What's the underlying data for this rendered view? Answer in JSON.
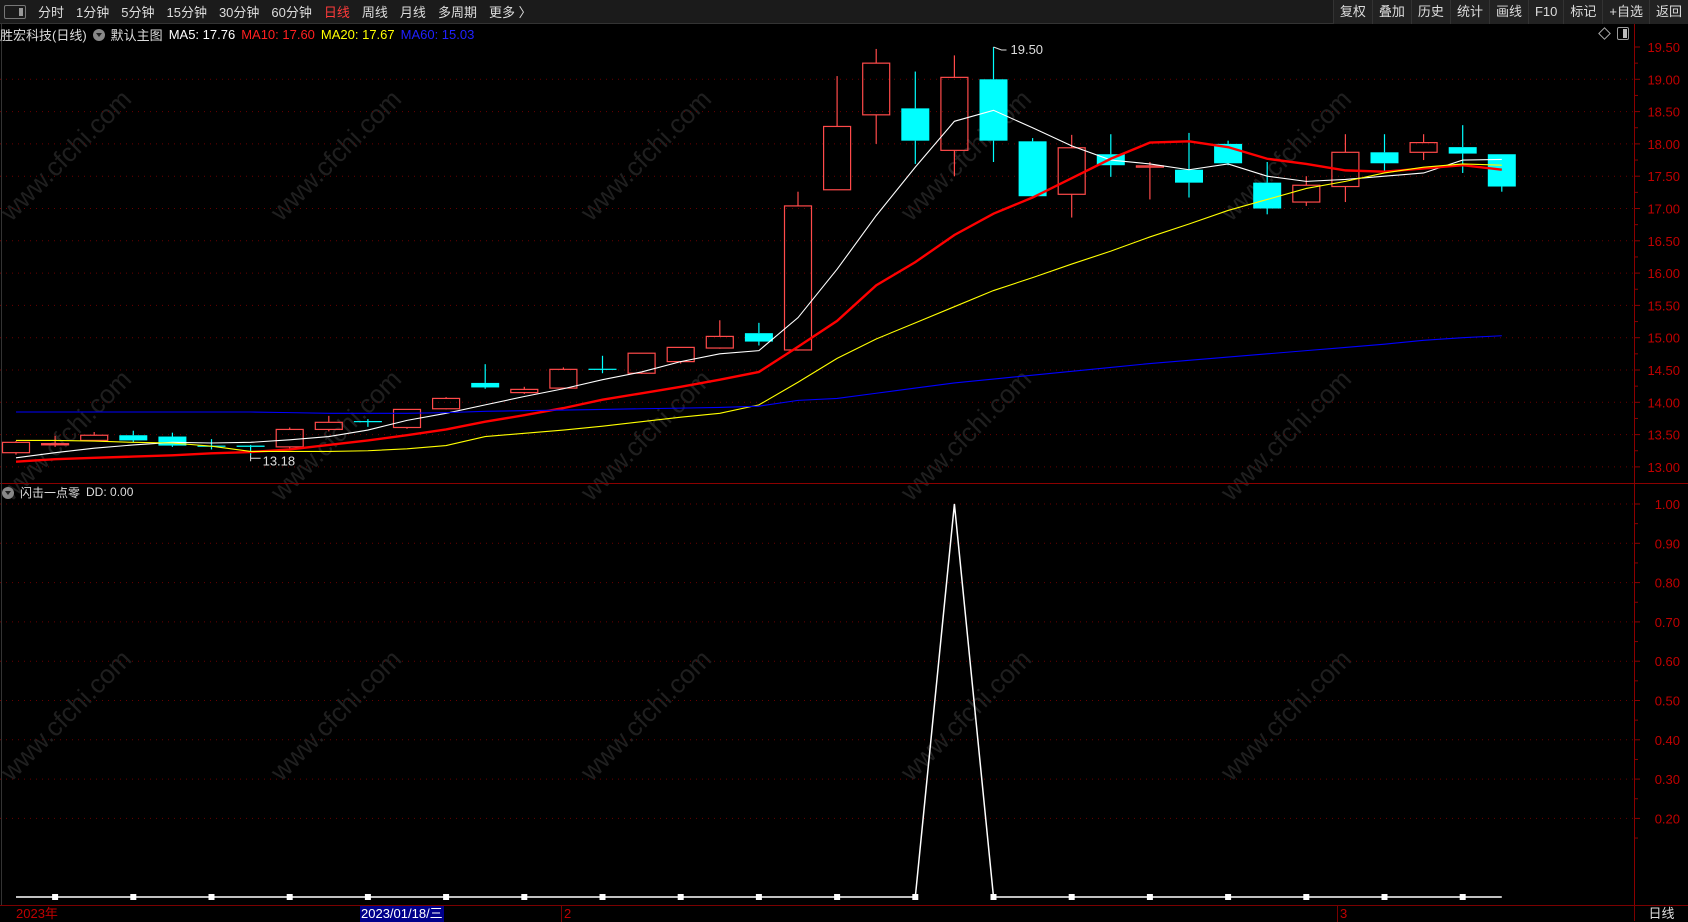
{
  "toolbar": {
    "periods": [
      "分时",
      "1分钟",
      "5分钟",
      "15分钟",
      "30分钟",
      "60分钟",
      "日线",
      "周线",
      "月线",
      "多周期",
      "更多 〉"
    ],
    "active_period": "日线",
    "right_buttons": [
      "复权",
      "叠加",
      "历史",
      "统计",
      "画线",
      "F10",
      "标记",
      "+自选",
      "返回"
    ]
  },
  "info": {
    "stock_name": "胜宏科技(日线)",
    "template": "默认主图",
    "ma5": "MA5: 17.76",
    "ma10": "MA10: 17.60",
    "ma20": "MA20: 17.67",
    "ma60": "MA60: 15.03"
  },
  "indicator": {
    "name": "闪击一点零",
    "value": "DD: 0.00"
  },
  "colors": {
    "up": "#ff4a4a",
    "down": "#00ffff",
    "ma5": "#ffffff",
    "ma10": "#ff0000",
    "ma20": "#ffff00",
    "ma60": "#0000ff",
    "axis": "#c00000"
  },
  "price_axis": {
    "ticks": [
      "19.50",
      "19.00",
      "18.50",
      "18.00",
      "17.50",
      "17.00",
      "16.50",
      "16.00",
      "15.50",
      "15.00",
      "14.50",
      "14.00",
      "13.50",
      "13.00"
    ]
  },
  "indicator_axis": {
    "ticks": [
      "1.00",
      "0.90",
      "0.80",
      "0.70",
      "0.60",
      "0.50",
      "0.40",
      "0.30",
      "0.20"
    ]
  },
  "annotations": {
    "high": "19.50",
    "low": "13.18"
  },
  "dates": {
    "year": "2023年",
    "selected": "2023/01/18/三",
    "month2": "2",
    "month3": "3"
  },
  "period_label": "日线",
  "watermark": "www.cfchi.com",
  "chart_data": {
    "type": "candlestick",
    "ylim": [
      12.9,
      19.6
    ],
    "candles": [
      [
        13.22,
        13.4,
        13.19,
        13.38
      ],
      [
        13.35,
        13.48,
        13.31,
        13.36
      ],
      [
        13.41,
        13.54,
        13.4,
        13.49
      ],
      [
        13.49,
        13.56,
        13.38,
        13.41
      ],
      [
        13.47,
        13.53,
        13.31,
        13.33
      ],
      [
        13.33,
        13.43,
        13.27,
        13.32
      ],
      [
        13.33,
        13.34,
        13.18,
        13.31
      ],
      [
        13.31,
        13.61,
        13.28,
        13.58
      ],
      [
        13.58,
        13.79,
        13.55,
        13.69
      ],
      [
        13.71,
        13.74,
        13.62,
        13.7
      ],
      [
        13.61,
        13.89,
        13.59,
        13.89
      ],
      [
        13.9,
        14.08,
        13.89,
        14.06
      ],
      [
        14.3,
        14.59,
        14.21,
        14.23
      ],
      [
        14.15,
        14.24,
        14.13,
        14.2
      ],
      [
        14.22,
        14.54,
        14.21,
        14.51
      ],
      [
        14.52,
        14.72,
        14.45,
        14.51
      ],
      [
        14.45,
        14.76,
        14.44,
        14.76
      ],
      [
        14.63,
        14.85,
        14.6,
        14.85
      ],
      [
        14.84,
        15.27,
        14.83,
        15.02
      ],
      [
        15.07,
        15.23,
        14.88,
        14.94
      ],
      [
        14.81,
        17.26,
        14.8,
        17.04
      ],
      [
        17.29,
        19.05,
        17.29,
        18.27
      ],
      [
        18.45,
        19.47,
        18.0,
        19.25
      ],
      [
        18.55,
        19.12,
        17.69,
        18.05
      ],
      [
        17.9,
        19.37,
        17.5,
        19.03
      ],
      [
        19.0,
        19.5,
        17.72,
        18.05
      ],
      [
        18.04,
        18.09,
        17.16,
        17.19
      ],
      [
        17.22,
        18.14,
        16.86,
        17.94
      ],
      [
        17.84,
        18.15,
        17.49,
        17.67
      ],
      [
        17.64,
        17.72,
        17.14,
        17.66
      ],
      [
        17.6,
        18.17,
        17.17,
        17.4
      ],
      [
        18.0,
        18.05,
        17.67,
        17.7
      ],
      [
        17.4,
        17.72,
        16.91,
        17.0
      ],
      [
        17.1,
        17.5,
        17.04,
        17.36
      ],
      [
        17.34,
        18.15,
        17.1,
        17.87
      ],
      [
        17.87,
        18.15,
        17.55,
        17.7
      ],
      [
        17.87,
        18.15,
        17.75,
        18.02
      ],
      [
        17.95,
        18.29,
        17.55,
        17.85
      ],
      [
        17.84,
        17.84,
        17.26,
        17.34
      ]
    ],
    "series": [
      {
        "name": "MA5",
        "values": [
          13.14,
          13.22,
          13.29,
          13.34,
          13.38,
          13.37,
          13.38,
          13.42,
          13.47,
          13.57,
          13.72,
          13.83,
          13.96,
          14.09,
          14.21,
          14.35,
          14.47,
          14.63,
          14.75,
          14.8,
          15.31,
          16.06,
          16.89,
          17.64,
          18.35,
          18.52,
          18.25,
          17.97,
          17.75,
          17.69,
          17.6,
          17.69,
          17.5,
          17.42,
          17.45,
          17.5,
          17.55,
          17.75,
          17.76
        ]
      },
      {
        "name": "MA10",
        "values": [
          13.08,
          13.12,
          13.14,
          13.16,
          13.18,
          13.21,
          13.23,
          13.27,
          13.34,
          13.41,
          13.49,
          13.58,
          13.7,
          13.8,
          13.91,
          14.04,
          14.14,
          14.24,
          14.35,
          14.47,
          14.86,
          15.26,
          15.81,
          16.17,
          16.59,
          16.92,
          17.17,
          17.47,
          17.77,
          18.02,
          18.04,
          17.95,
          17.77,
          17.69,
          17.59,
          17.57,
          17.62,
          17.67,
          17.6
        ]
      },
      {
        "name": "MA20",
        "values": [
          13.41,
          13.41,
          13.4,
          13.38,
          13.37,
          13.32,
          13.24,
          13.24,
          13.24,
          13.25,
          13.28,
          13.33,
          13.47,
          13.52,
          13.57,
          13.63,
          13.7,
          13.77,
          13.83,
          13.96,
          14.31,
          14.68,
          14.98,
          15.23,
          15.48,
          15.73,
          15.93,
          16.14,
          16.34,
          16.56,
          16.76,
          16.97,
          17.14,
          17.31,
          17.42,
          17.55,
          17.64,
          17.69,
          17.67
        ]
      },
      {
        "name": "MA60",
        "values": [
          13.85,
          13.85,
          13.85,
          13.85,
          13.85,
          13.85,
          13.85,
          13.84,
          13.83,
          13.83,
          13.83,
          13.84,
          13.86,
          13.87,
          13.88,
          13.89,
          13.9,
          13.91,
          13.92,
          13.94,
          14.03,
          14.06,
          14.14,
          14.22,
          14.3,
          14.36,
          14.42,
          14.48,
          14.54,
          14.6,
          14.65,
          14.7,
          14.75,
          14.8,
          14.85,
          14.9,
          14.96,
          15.0,
          15.03
        ]
      }
    ],
    "indicator": {
      "name": "DD",
      "ylim": [
        0,
        1
      ],
      "values": [
        0,
        0,
        0,
        0,
        0,
        0,
        0,
        0,
        0,
        0,
        0,
        0,
        0,
        0,
        0,
        0,
        0,
        0,
        0,
        0,
        0,
        0,
        0,
        0,
        1,
        0,
        0,
        0,
        0,
        0,
        0,
        0,
        0,
        0,
        0,
        0,
        0,
        0,
        0
      ]
    }
  }
}
